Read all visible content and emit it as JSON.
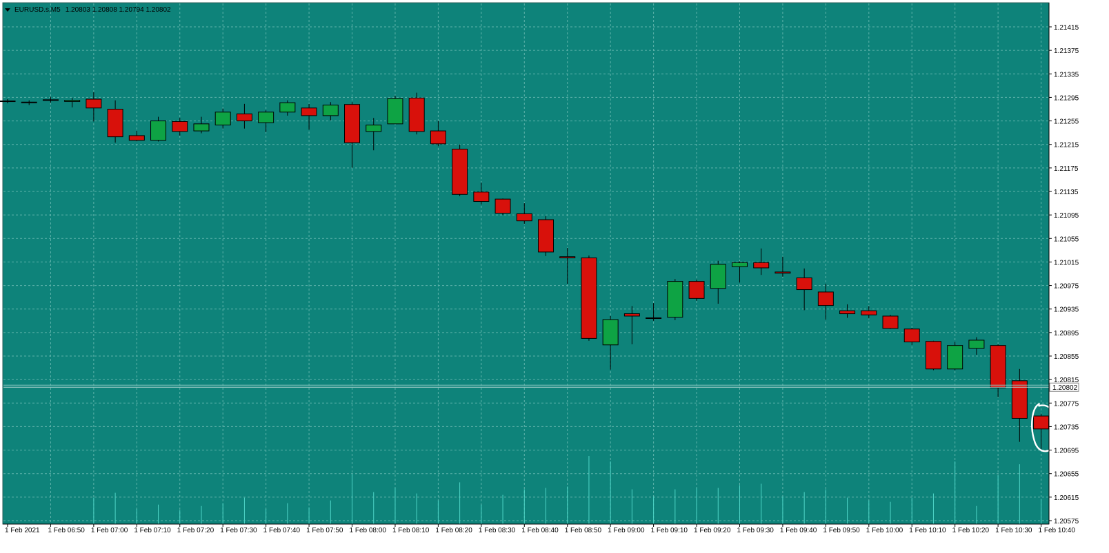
{
  "header": {
    "symbol": "EURUSD.s,M5",
    "ohlc": "1.20803 1.20808 1.20794 1.20802"
  },
  "colors": {
    "background": "#0e837a",
    "grid": "#5fb3ab",
    "bull": "#0ea344",
    "bear": "#d8110b",
    "wick": "#000000",
    "volume": "#4fd6c8",
    "annotation": "#ffffff"
  },
  "chart_data": {
    "type": "candlestick",
    "symbol": "EURUSD.s",
    "timeframe": "M5",
    "y_ticks": [
      "1.21415",
      "1.21375",
      "1.21335",
      "1.21295",
      "1.21255",
      "1.21215",
      "1.21175",
      "1.21135",
      "1.21095",
      "1.21055",
      "1.21015",
      "1.20975",
      "1.20935",
      "1.20895",
      "1.20855",
      "1.20815",
      "1.20775",
      "1.20735",
      "1.20695",
      "1.20655",
      "1.20615",
      "1.20575"
    ],
    "ylim": [
      1.20565,
      1.21435
    ],
    "current_price": "1.20802",
    "x_labels": [
      "1 Feb 2021",
      "1 Feb 06:50",
      "1 Feb 07:00",
      "1 Feb 07:10",
      "1 Feb 07:20",
      "1 Feb 07:30",
      "1 Feb 07:40",
      "1 Feb 07:50",
      "1 Feb 08:00",
      "1 Feb 08:10",
      "1 Feb 08:20",
      "1 Feb 08:30",
      "1 Feb 08:40",
      "1 Feb 08:50",
      "1 Feb 09:00",
      "1 Feb 09:10",
      "1 Feb 09:20",
      "1 Feb 09:30",
      "1 Feb 09:40",
      "1 Feb 09:50",
      "1 Feb 10:00",
      "1 Feb 10:10",
      "1 Feb 10:20",
      "1 Feb 10:30",
      "1 Feb 10:40"
    ],
    "candles": [
      {
        "o": 1.21288,
        "h": 1.21292,
        "l": 1.21285,
        "c": 1.21289
      },
      {
        "o": 1.21286,
        "h": 1.2129,
        "l": 1.21282,
        "c": 1.21287
      },
      {
        "o": 1.2129,
        "h": 1.21296,
        "l": 1.21286,
        "c": 1.21291
      },
      {
        "o": 1.21288,
        "h": 1.21294,
        "l": 1.21278,
        "c": 1.2129
      },
      {
        "o": 1.21292,
        "h": 1.21304,
        "l": 1.21254,
        "c": 1.21277
      },
      {
        "o": 1.21275,
        "h": 1.2129,
        "l": 1.21218,
        "c": 1.21228
      },
      {
        "o": 1.2123,
        "h": 1.21238,
        "l": 1.2122,
        "c": 1.21222
      },
      {
        "o": 1.21222,
        "h": 1.21262,
        "l": 1.2122,
        "c": 1.21255
      },
      {
        "o": 1.21254,
        "h": 1.2126,
        "l": 1.2123,
        "c": 1.21237
      },
      {
        "o": 1.21238,
        "h": 1.21262,
        "l": 1.21234,
        "c": 1.2125
      },
      {
        "o": 1.21248,
        "h": 1.21276,
        "l": 1.21242,
        "c": 1.2127
      },
      {
        "o": 1.21267,
        "h": 1.21284,
        "l": 1.21242,
        "c": 1.21255
      },
      {
        "o": 1.21252,
        "h": 1.21273,
        "l": 1.21236,
        "c": 1.2127
      },
      {
        "o": 1.2127,
        "h": 1.2129,
        "l": 1.21264,
        "c": 1.21286
      },
      {
        "o": 1.21277,
        "h": 1.21284,
        "l": 1.2124,
        "c": 1.21264
      },
      {
        "o": 1.21264,
        "h": 1.21287,
        "l": 1.21256,
        "c": 1.21282
      },
      {
        "o": 1.21283,
        "h": 1.21287,
        "l": 1.21175,
        "c": 1.21218
      },
      {
        "o": 1.21237,
        "h": 1.2126,
        "l": 1.21205,
        "c": 1.21248
      },
      {
        "o": 1.2125,
        "h": 1.21298,
        "l": 1.2125,
        "c": 1.21293
      },
      {
        "o": 1.21294,
        "h": 1.21303,
        "l": 1.21232,
        "c": 1.21237
      },
      {
        "o": 1.21238,
        "h": 1.21255,
        "l": 1.21212,
        "c": 1.21216
      },
      {
        "o": 1.21207,
        "h": 1.21215,
        "l": 1.21127,
        "c": 1.2113
      },
      {
        "o": 1.21134,
        "h": 1.2115,
        "l": 1.21113,
        "c": 1.21118
      },
      {
        "o": 1.21122,
        "h": 1.21123,
        "l": 1.21095,
        "c": 1.21098
      },
      {
        "o": 1.21097,
        "h": 1.21115,
        "l": 1.2108,
        "c": 1.21085
      },
      {
        "o": 1.21087,
        "h": 1.21093,
        "l": 1.21025,
        "c": 1.21032
      },
      {
        "o": 1.21024,
        "h": 1.21039,
        "l": 1.20978,
        "c": 1.21022
      },
      {
        "o": 1.21022,
        "h": 1.21026,
        "l": 1.20881,
        "c": 1.20885
      },
      {
        "o": 1.20874,
        "h": 1.20923,
        "l": 1.20832,
        "c": 1.20917
      },
      {
        "o": 1.20927,
        "h": 1.2094,
        "l": 1.20875,
        "c": 1.20923
      },
      {
        "o": 1.2092,
        "h": 1.20945,
        "l": 1.20915,
        "c": 1.2092
      },
      {
        "o": 1.20921,
        "h": 1.20986,
        "l": 1.20916,
        "c": 1.20982
      },
      {
        "o": 1.20982,
        "h": 1.20985,
        "l": 1.20949,
        "c": 1.20953
      },
      {
        "o": 1.2097,
        "h": 1.21017,
        "l": 1.20944,
        "c": 1.21011
      },
      {
        "o": 1.21007,
        "h": 1.21016,
        "l": 1.2098,
        "c": 1.21014
      },
      {
        "o": 1.21014,
        "h": 1.21038,
        "l": 1.20993,
        "c": 1.21005
      },
      {
        "o": 1.20998,
        "h": 1.21024,
        "l": 1.2099,
        "c": 1.20996
      },
      {
        "o": 1.20988,
        "h": 1.21004,
        "l": 1.20933,
        "c": 1.20968
      },
      {
        "o": 1.20964,
        "h": 1.20978,
        "l": 1.20917,
        "c": 1.20941
      },
      {
        "o": 1.20932,
        "h": 1.20943,
        "l": 1.2092,
        "c": 1.20927
      },
      {
        "o": 1.20932,
        "h": 1.2094,
        "l": 1.20919,
        "c": 1.20925
      },
      {
        "o": 1.20923,
        "h": 1.20925,
        "l": 1.20901,
        "c": 1.20902
      },
      {
        "o": 1.20901,
        "h": 1.20903,
        "l": 1.20874,
        "c": 1.20879
      },
      {
        "o": 1.2088,
        "h": 1.20881,
        "l": 1.20831,
        "c": 1.20833
      },
      {
        "o": 1.20833,
        "h": 1.20879,
        "l": 1.20831,
        "c": 1.20873
      },
      {
        "o": 1.20868,
        "h": 1.20887,
        "l": 1.20857,
        "c": 1.20882
      },
      {
        "o": 1.20873,
        "h": 1.20875,
        "l": 1.20785,
        "c": 1.20801
      },
      {
        "o": 1.20813,
        "h": 1.20833,
        "l": 1.20709,
        "c": 1.20749
      },
      {
        "o": 1.20753,
        "h": 1.20757,
        "l": 1.20697,
        "c": 1.20731
      }
    ],
    "volumes": [
      0.0,
      0.0,
      0.0,
      0.0,
      0.38,
      0.45,
      0.22,
      0.28,
      0.2,
      0.26,
      0.3,
      0.38,
      0.22,
      0.3,
      0.24,
      0.34,
      0.72,
      0.46,
      0.52,
      0.44,
      0.34,
      0.6,
      0.28,
      0.42,
      0.5,
      0.52,
      0.54,
      0.98,
      0.9,
      0.5,
      0.4,
      0.5,
      0.52,
      0.52,
      0.56,
      0.58,
      0.4,
      0.46,
      0.5,
      0.38,
      0.34,
      0.32,
      0.38,
      0.44,
      0.9,
      0.26,
      0.7,
      0.86,
      0.36
    ]
  }
}
